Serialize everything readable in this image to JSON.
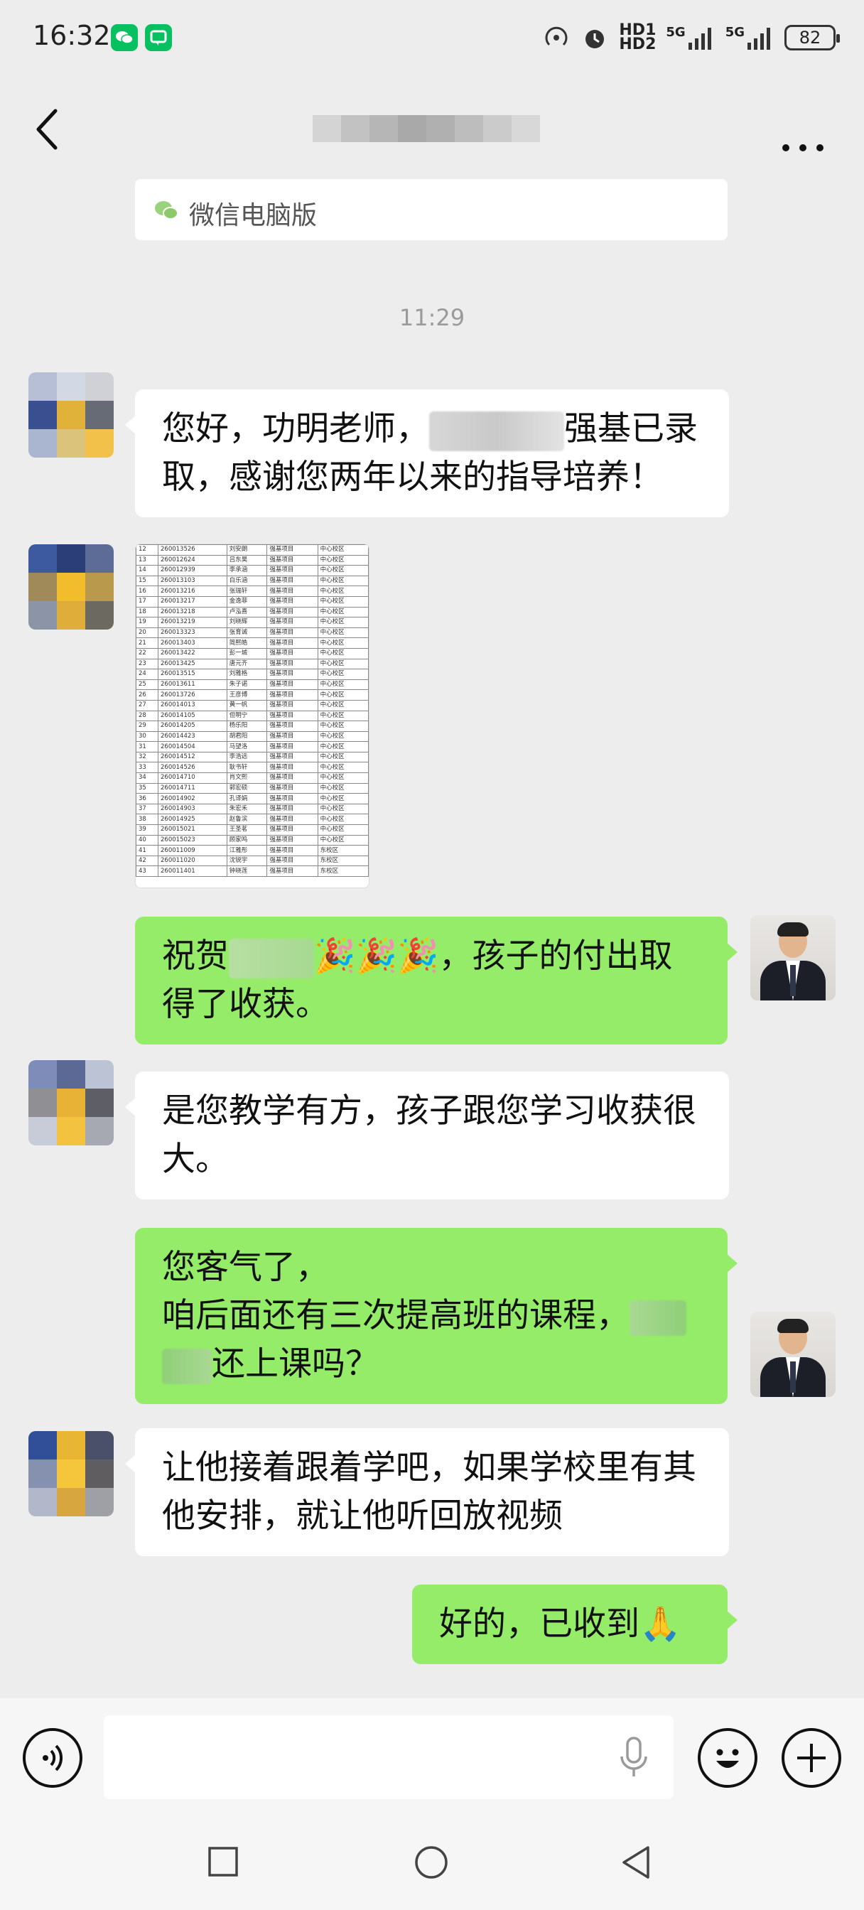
{
  "status_bar": {
    "time": "16:32",
    "signal1": "5G",
    "signal2": "5G",
    "hd1": "HD1",
    "hd2": "HD2",
    "battery": "82",
    "colors": {
      "wechat": "#07c160",
      "msg_app": "#07c160"
    }
  },
  "header": {
    "back_icon": "chevron-left-icon",
    "title_blurred": true,
    "more_icon": "more-icon"
  },
  "chat": {
    "top_notice": "微信电脑版",
    "timestamp": "11:29",
    "messages": [
      {
        "id": 1,
        "direction": "in",
        "part1": "您好，功明老师，",
        "part2": "强基已录取，感谢您两年以来的指导培养！"
      },
      {
        "id": 2,
        "direction": "in",
        "type": "image"
      },
      {
        "id": 3,
        "direction": "out",
        "part1": "祝贺",
        "emoji": "🎉🎉🎉",
        "part2": "，孩子的付出取得了收获。"
      },
      {
        "id": 4,
        "direction": "in",
        "text": "是您教学有方，孩子跟您学习收获很大。"
      },
      {
        "id": 5,
        "direction": "out",
        "line1": "您客气了，",
        "line2": "咱后面还有三次提高班的课程，",
        "line3": "还上课吗？"
      },
      {
        "id": 6,
        "direction": "in",
        "text": "让他接着跟着学吧，如果学校里有其他安排，就让他听回放视频"
      },
      {
        "id": 7,
        "direction": "out",
        "text": "好的，已收到",
        "emoji": "🙏"
      }
    ],
    "image_table": {
      "rows": [
        [
          "12",
          "260013526",
          "刘安朗",
          "强基项目",
          "中心校区"
        ],
        [
          "13",
          "260012624",
          "吕东昊",
          "强基项目",
          "中心校区"
        ],
        [
          "14",
          "260012939",
          "李承涵",
          "强基项目",
          "中心校区"
        ],
        [
          "15",
          "260013103",
          "白乐涵",
          "强基项目",
          "中心校区"
        ],
        [
          "16",
          "260013216",
          "张瑞轩",
          "强基项目",
          "中心校区"
        ],
        [
          "17",
          "260013217",
          "金逸菲",
          "强基项目",
          "中心校区"
        ],
        [
          "18",
          "260013218",
          "卢泓喜",
          "强基项目",
          "中心校区"
        ],
        [
          "19",
          "260013219",
          "刘晓辉",
          "强基项目",
          "中心校区"
        ],
        [
          "20",
          "260013323",
          "张育诚",
          "强基项目",
          "中心校区"
        ],
        [
          "21",
          "260013403",
          "简熙皓",
          "强基项目",
          "中心校区"
        ],
        [
          "22",
          "260013422",
          "彭一城",
          "强基项目",
          "中心校区"
        ],
        [
          "23",
          "260013425",
          "唐元齐",
          "强基项目",
          "中心校区"
        ],
        [
          "24",
          "260013515",
          "刘雅格",
          "强基项目",
          "中心校区"
        ],
        [
          "25",
          "260013611",
          "朱子诺",
          "强基项目",
          "中心校区"
        ],
        [
          "26",
          "260013726",
          "王彦博",
          "强基项目",
          "中心校区"
        ],
        [
          "27",
          "260014013",
          "黄一帆",
          "强基项目",
          "中心校区"
        ],
        [
          "28",
          "260014105",
          "但明宁",
          "强基项目",
          "中心校区"
        ],
        [
          "29",
          "260014205",
          "杨乐阳",
          "强基项目",
          "中心校区"
        ],
        [
          "30",
          "260014423",
          "胡君阳",
          "强基项目",
          "中心校区"
        ],
        [
          "31",
          "260014504",
          "马望洛",
          "强基项目",
          "中心校区"
        ],
        [
          "32",
          "260014512",
          "李浩远",
          "强基项目",
          "中心校区"
        ],
        [
          "33",
          "260014526",
          "耿书轩",
          "强基项目",
          "中心校区"
        ],
        [
          "34",
          "260014710",
          "肖文熙",
          "强基项目",
          "中心校区"
        ],
        [
          "35",
          "260014711",
          "郭宏硕",
          "强基项目",
          "中心校区"
        ],
        [
          "36",
          "260014902",
          "孔译娟",
          "强基项目",
          "中心校区"
        ],
        [
          "37",
          "260014903",
          "朱宏禾",
          "强基项目",
          "中心校区"
        ],
        [
          "38",
          "260014925",
          "赵鲁滨",
          "强基项目",
          "中心校区"
        ],
        [
          "39",
          "260015021",
          "王圣茗",
          "强基项目",
          "中心校区"
        ],
        [
          "40",
          "260015023",
          "顾家鸣",
          "强基项目",
          "中心校区"
        ],
        [
          "41",
          "260011009",
          "江雅彤",
          "强基项目",
          "东校区"
        ],
        [
          "42",
          "260011020",
          "沈锐宇",
          "强基项目",
          "东校区"
        ],
        [
          "43",
          "260011401",
          "钟晓莲",
          "强基项目",
          "东校区"
        ]
      ]
    }
  },
  "input_bar": {
    "voice_icon": "voice-icon",
    "mic_icon": "mic-icon",
    "emoji_icon": "emoji-icon",
    "plus_icon": "plus-icon"
  },
  "nav_bar": {
    "icons": [
      "recent-apps-icon",
      "home-icon",
      "back-icon"
    ]
  }
}
